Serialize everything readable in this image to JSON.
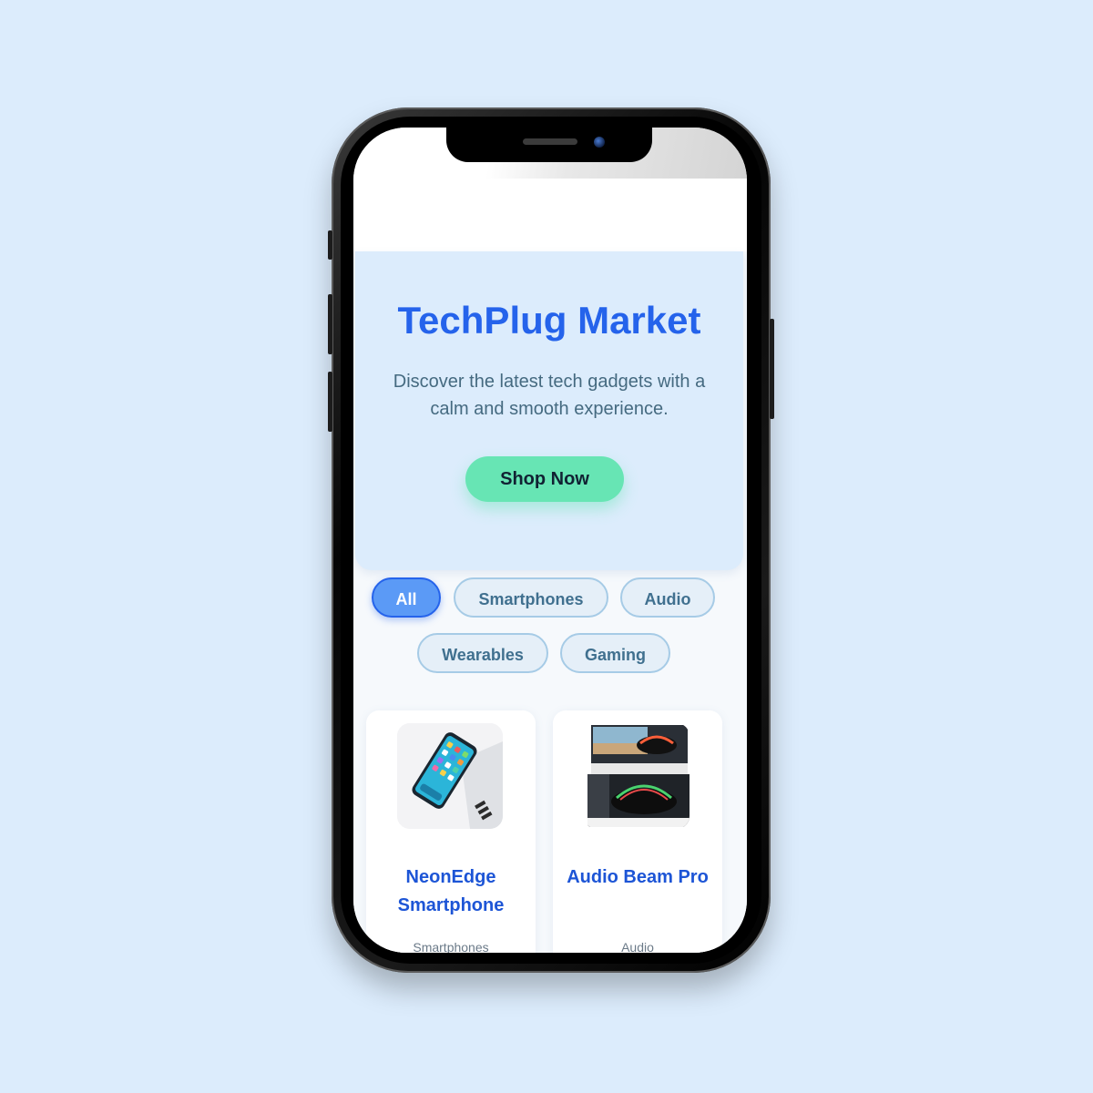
{
  "app": {
    "hero": {
      "title": "TechPlug Market",
      "subtitle": "Discover the latest tech gadgets with a calm and smooth experience.",
      "cta_label": "Shop Now"
    },
    "filters": [
      {
        "label": "All",
        "active": true
      },
      {
        "label": "Smartphones",
        "active": false
      },
      {
        "label": "Audio",
        "active": false
      },
      {
        "label": "Wearables",
        "active": false
      },
      {
        "label": "Gaming",
        "active": false
      }
    ],
    "products": [
      {
        "name": "NeonEdge Smartphone",
        "category": "Smartphones",
        "image_icon": "smartphone-icon"
      },
      {
        "name": "Audio Beam Pro",
        "category": "Audio",
        "image_icon": "speaker-box-icon"
      }
    ]
  },
  "colors": {
    "page_background": "#dcecfc",
    "brand_blue": "#2563eb",
    "cta_green": "#67e5b4",
    "chip_active": "#5b9af6"
  }
}
